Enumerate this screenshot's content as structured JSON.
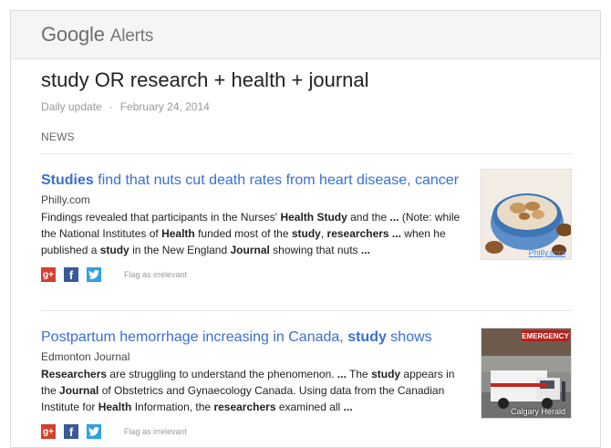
{
  "header": {
    "brand_google": "Google",
    "brand_alerts": "Alerts"
  },
  "alert": {
    "query": "study OR research + health + journal",
    "frequency": "Daily update",
    "separator": "·",
    "date": "February 24, 2014"
  },
  "section": "NEWS",
  "share": {
    "gplus": "g+",
    "facebook": "f",
    "twitter": "t",
    "flag": "Flag as irrelevant"
  },
  "articles": [
    {
      "title_bold": "Studies",
      "title_rest": " find that nuts cut death rates from heart disease, cancer",
      "source": "Philly.com",
      "snippet": [
        {
          "t": "Findings revealed that participants in the Nurses' "
        },
        {
          "b": "Health Study"
        },
        {
          "t": " and the "
        },
        {
          "b": "..."
        },
        {
          "t": " (Note: while the National Institutes of "
        },
        {
          "b": "Health"
        },
        {
          "t": " funded most of the "
        },
        {
          "b": "study"
        },
        {
          "t": ", "
        },
        {
          "b": "researchers ..."
        },
        {
          "t": " when he published a "
        },
        {
          "b": "study"
        },
        {
          "t": " in the New England "
        },
        {
          "b": "Journal"
        },
        {
          "t": " showing that nuts "
        },
        {
          "b": "..."
        }
      ],
      "image_caption": "Philly.com"
    },
    {
      "title_rest": "Postpartum hemorrhage increasing in Canada, ",
      "title_bold": "study",
      "title_tail": " shows",
      "source": "Edmonton Journal",
      "snippet": [
        {
          "b": "Researchers"
        },
        {
          "t": " are struggling to understand the phenomenon. "
        },
        {
          "b": "..."
        },
        {
          "t": " The "
        },
        {
          "b": "study"
        },
        {
          "t": " appears in the "
        },
        {
          "b": "Journal"
        },
        {
          "t": " of Obstetrics and Gynaecology Canada. Using data from the Canadian Institute for "
        },
        {
          "b": "Health"
        },
        {
          "t": " Information, the "
        },
        {
          "b": "researchers"
        },
        {
          "t": " examined all "
        },
        {
          "b": "..."
        }
      ],
      "image_caption": "Calgary Herald",
      "image_sign": "EMERGENCY"
    }
  ]
}
